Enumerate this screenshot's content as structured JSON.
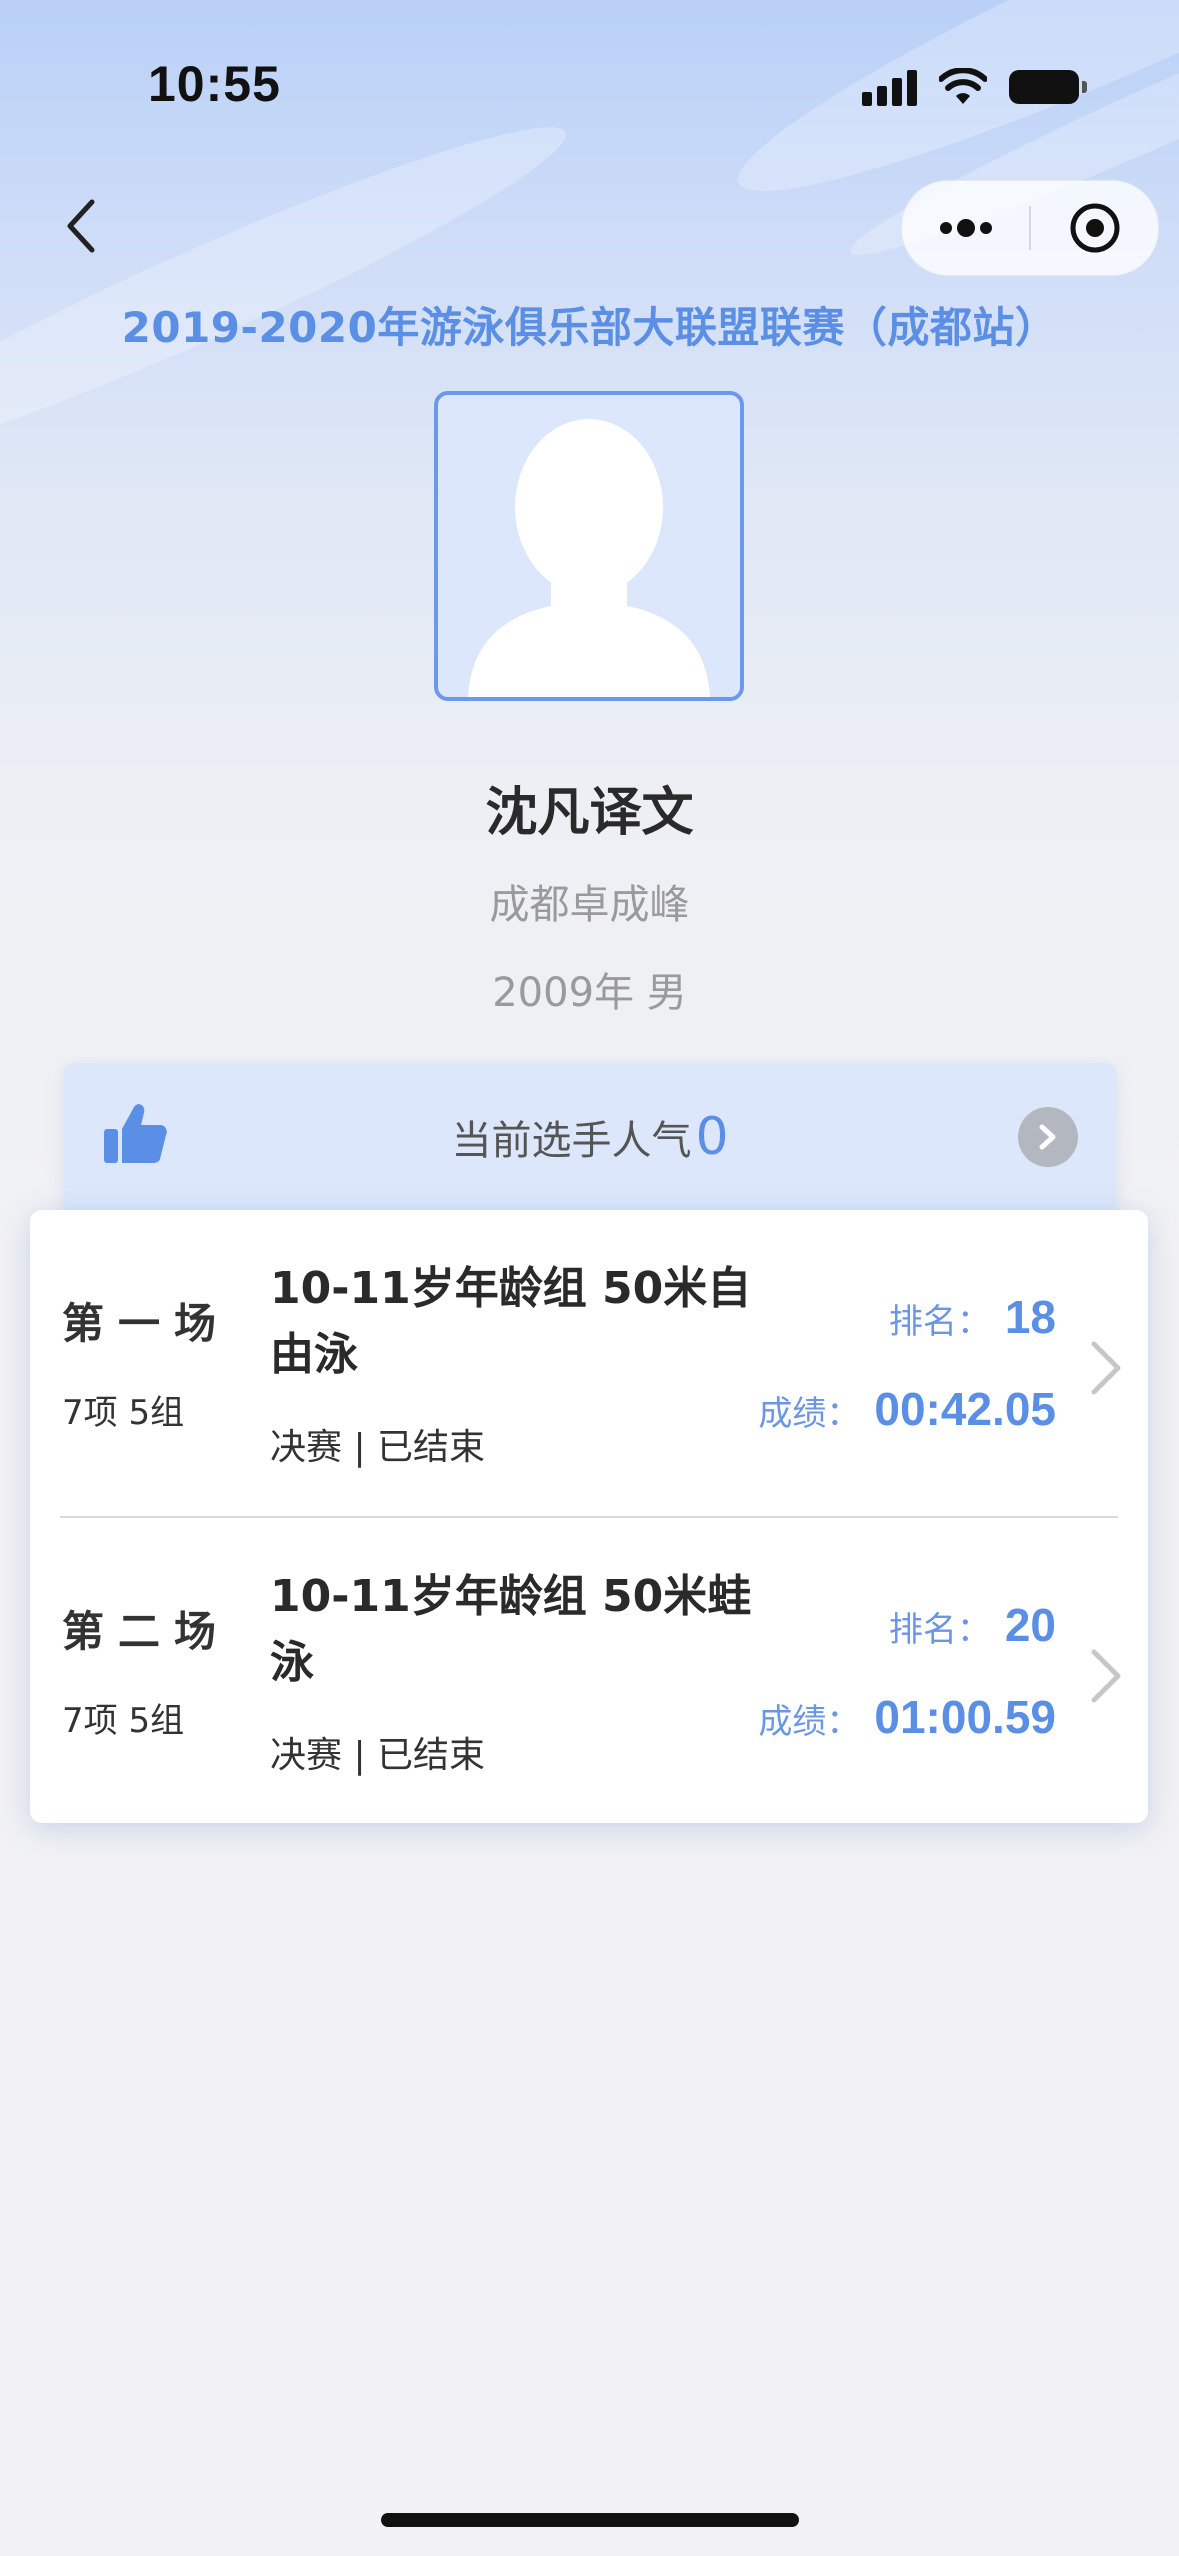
{
  "status_bar": {
    "time": "10:55"
  },
  "nav": {
    "back_icon": "chevron-left-icon",
    "more_icon": "more-dots-icon",
    "close_icon": "target-circle-icon"
  },
  "event": {
    "title": "2019-2020年游泳俱乐部大联盟联赛（成都站）"
  },
  "player": {
    "name": "沈凡译文",
    "club": "成都卓成峰",
    "info": "2009年 男"
  },
  "popularity": {
    "label": "当前选手人气",
    "count": "0",
    "like_icon": "thumbs-up-icon",
    "arrow_icon": "chevron-right-circle-icon"
  },
  "results": [
    {
      "session": "第一场",
      "heat": "7项 5组",
      "event": "10-11岁年龄组 50米自由泳",
      "status": "决赛 | 已结束",
      "rank_label": "排名：",
      "rank": "18",
      "score_label": "成绩：",
      "score": "00:42.05"
    },
    {
      "session": "第二场",
      "heat": "7项 5组",
      "event": "10-11岁年龄组 50米蛙泳",
      "status": "决赛 | 已结束",
      "rank_label": "排名：",
      "rank": "20",
      "score_label": "成绩：",
      "score": "01:00.59"
    }
  ],
  "colors": {
    "accent": "#5b8fe6",
    "title_text": "#2a2a2a",
    "muted_text": "#9a9a9a"
  }
}
